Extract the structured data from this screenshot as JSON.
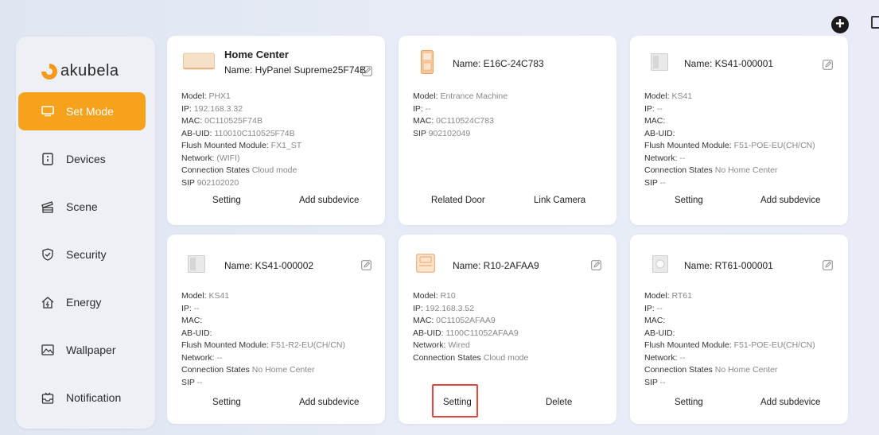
{
  "header": {
    "add_icon": "plus-circle-icon",
    "exit_icon": "exit-icon"
  },
  "logo": {
    "text": "akubela",
    "color": "#f39a1d"
  },
  "sidebar": {
    "items": [
      {
        "label": "Set Mode",
        "icon": "monitor-icon",
        "active": true
      },
      {
        "label": "Devices",
        "icon": "device-panel-icon"
      },
      {
        "label": "Scene",
        "icon": "scene-icon"
      },
      {
        "label": "Security",
        "icon": "shield-icon"
      },
      {
        "label": "Energy",
        "icon": "energy-home-icon"
      },
      {
        "label": "Wallpaper",
        "icon": "image-icon"
      },
      {
        "label": "Notification",
        "icon": "inbox-icon"
      }
    ],
    "accent": "#f6a21c"
  },
  "cards": [
    {
      "title": "Home Center",
      "name": "Name:  HyPanel Supreme25F74B",
      "lines": [
        {
          "k": "Model:",
          "v": "PHX1"
        },
        {
          "k": "IP:",
          "v": "192.168.3.32"
        },
        {
          "k": "MAC:",
          "v": "0C110525F74B"
        },
        {
          "k": "AB-UID:",
          "v": "110010C110525F74B"
        },
        {
          "k": "Flush Mounted Module:",
          "v": "FX1_ST"
        },
        {
          "k": "Network:",
          "v": "(WIFI)"
        },
        {
          "k": "Connection States",
          "v": "Cloud mode"
        },
        {
          "k": "SIP",
          "v": "902102020"
        }
      ],
      "actions": [
        "Setting",
        "Add subdevice"
      ]
    },
    {
      "name": "Name:  E16C-24C783",
      "lines": [
        {
          "k": "Model:",
          "v": "Entrance Machine"
        },
        {
          "k": "IP:",
          "v": "--"
        },
        {
          "k": "MAC:",
          "v": "0C110524C783"
        },
        {
          "k": "SIP",
          "v": "902102049"
        }
      ],
      "actions": [
        "Related Door",
        "Link Camera"
      ]
    },
    {
      "name": "Name:  KS41-000001",
      "lines": [
        {
          "k": "Model:",
          "v": "KS41"
        },
        {
          "k": "IP:",
          "v": "--"
        },
        {
          "k": "MAC:",
          "v": ""
        },
        {
          "k": "AB-UID:",
          "v": ""
        },
        {
          "k": "Flush Mounted Module:",
          "v": "F51-POE-EU(CH/CN)"
        },
        {
          "k": "Network:",
          "v": "--"
        },
        {
          "k": "Connection States",
          "v": "No Home Center"
        },
        {
          "k": "SIP",
          "v": "--"
        }
      ],
      "actions": [
        "Setting",
        "Add subdevice"
      ]
    },
    {
      "name": "Name:  KS41-000002",
      "lines": [
        {
          "k": "Model:",
          "v": "KS41"
        },
        {
          "k": "IP:",
          "v": "--"
        },
        {
          "k": "MAC:",
          "v": ""
        },
        {
          "k": "AB-UID:",
          "v": ""
        },
        {
          "k": "Flush Mounted Module:",
          "v": "F51-R2-EU(CH/CN)"
        },
        {
          "k": "Network:",
          "v": "--"
        },
        {
          "k": "Connection States",
          "v": "No Home Center"
        },
        {
          "k": "SIP",
          "v": "--"
        }
      ],
      "actions": [
        "Setting",
        "Add subdevice"
      ]
    },
    {
      "name": "Name:  R10-2AFAA9",
      "lines": [
        {
          "k": "Model:",
          "v": "R10"
        },
        {
          "k": "IP:",
          "v": "192.168.3.52"
        },
        {
          "k": "MAC:",
          "v": "0C11052AFAA9"
        },
        {
          "k": "AB-UID:",
          "v": "1100C11052AFAA9"
        },
        {
          "k": "Network:",
          "v": "Wired"
        },
        {
          "k": "Connection States",
          "v": "Cloud mode"
        }
      ],
      "actions": [
        "Setting",
        "Delete"
      ]
    },
    {
      "name": "Name:  RT61-000001",
      "lines": [
        {
          "k": "Model:",
          "v": "RT61"
        },
        {
          "k": "IP:",
          "v": "--"
        },
        {
          "k": "MAC:",
          "v": ""
        },
        {
          "k": "AB-UID:",
          "v": ""
        },
        {
          "k": "Flush Mounted Module:",
          "v": "F51-POE-EU(CH/CN)"
        },
        {
          "k": "Network:",
          "v": "--"
        },
        {
          "k": "Connection States",
          "v": "No Home Center"
        },
        {
          "k": "SIP",
          "v": "--"
        }
      ],
      "actions": [
        "Setting",
        "Add subdevice"
      ]
    }
  ],
  "highlight_color": "#e0463c"
}
